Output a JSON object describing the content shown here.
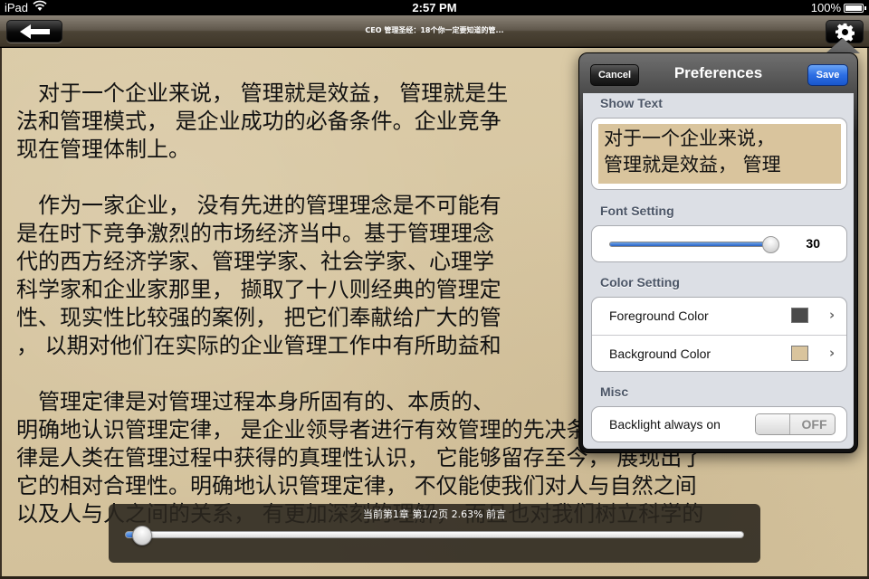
{
  "status_bar": {
    "carrier": "iPad",
    "wifi_icon": "wifi-icon",
    "time": "2:57 PM",
    "battery_percent": "100%",
    "battery_icon": "battery-icon"
  },
  "nav_bar": {
    "back_icon": "arrow-left-icon",
    "title": "CEO 管理圣经：18个你一定要知道的管...",
    "settings_icon": "gear-icon"
  },
  "book": {
    "lines": [
      "　对于一个企业来说， 管理就是效益， 管理就是生",
      "法和管理模式， 是企业成功的必备条件。企业竞争",
      "现在管理体制上。",
      "",
      "　作为一家企业， 没有先进的管理理念是不可能有",
      "是在时下竞争激烈的市场经济当中。基于管理理念",
      "代的西方经济学家、管理学家、社会学家、心理学",
      "科学家和企业家那里， 撷取了十八则经典的管理定",
      "性、现实性比较强的案例， 把它们奉献给广大的管",
      "， 以期对他们在实际的企业管理工作中有所助益和",
      "",
      "　管理定律是对管理过程本身所固有的、本质的、",
      "明确地认识管理定律， 是企业领导者进行有效管理的先决条件。管理定",
      "律是人类在管理过程中获得的真理性认识， 它能够留存至今， 展现出了",
      "它的相对合理性。明确地认识管理定律， 不仅能使我们对人与自然之间",
      "以及人与人之间的关系， 有更加深刻的理解， 而且也对我们树立科学的"
    ]
  },
  "progress": {
    "label": "当前第1章 第1/2页 2.63% 前言",
    "percent": 2.63
  },
  "preferences": {
    "title": "Preferences",
    "cancel_label": "Cancel",
    "save_label": "Save",
    "show_text": {
      "header": "Show Text",
      "preview_lines": [
        "对于一个企业来说，",
        "管理就是效益， 管理"
      ]
    },
    "font_setting": {
      "header": "Font Setting",
      "value": "30",
      "slider_fraction": 0.97
    },
    "color_setting": {
      "header": "Color Setting",
      "rows": [
        {
          "label": "Foreground Color",
          "swatch": "#4a4a4a",
          "chevron_icon": "chevron-right-icon"
        },
        {
          "label": "Background Color",
          "swatch": "#d9c49d",
          "chevron_icon": "chevron-right-icon"
        }
      ]
    },
    "misc": {
      "header": "Misc",
      "backlight_label": "Backlight always on",
      "backlight_state": "OFF"
    }
  },
  "colors": {
    "accent_blue": "#2c6ee3",
    "page_background": "#d8c7a3",
    "text": "#111111"
  }
}
